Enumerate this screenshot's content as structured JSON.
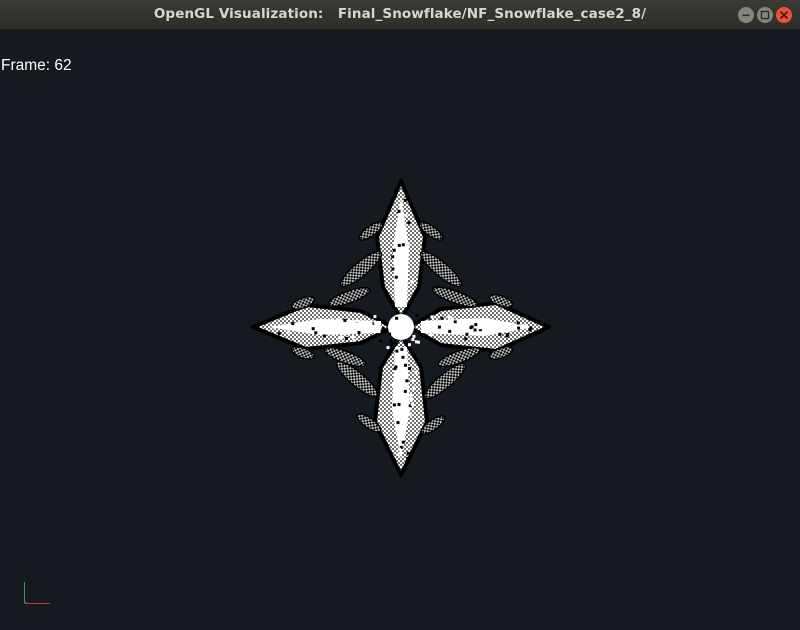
{
  "window": {
    "title": "OpenGL Visualization:   Final_Snowflake/NF_Snowflake_case2_8/",
    "buttons": {
      "minimize_icon": "minimize-icon",
      "maximize_icon": "maximize-icon",
      "close_icon": "close-icon"
    },
    "colors": {
      "titlebar": "#2e2d2a",
      "close_button": "#e9552a",
      "other_buttons": "#868580"
    }
  },
  "viewport": {
    "background": "#141a1f",
    "frame": {
      "label": "Frame:",
      "value": "62"
    },
    "axes": {
      "x_color": "#d23a3a",
      "y_color": "#3aa04a",
      "z_color": "#3a5ad2"
    },
    "snowflake_colors": {
      "bright": "#ffffff",
      "mid": "#bfbfbf",
      "dark": "#6e6e6e",
      "outline": "#000000"
    }
  }
}
